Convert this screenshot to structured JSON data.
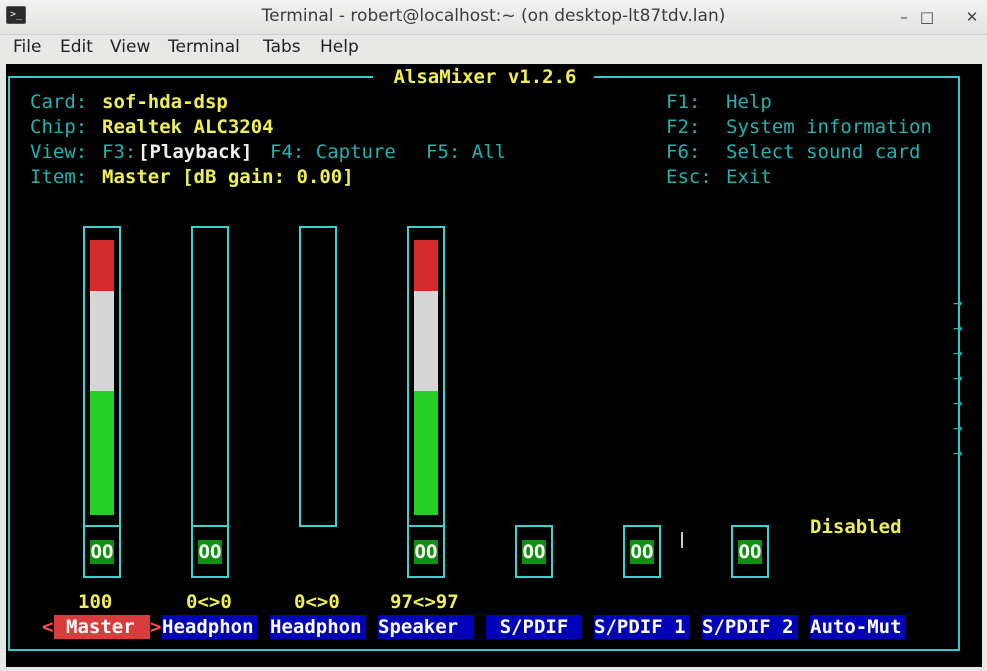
{
  "window": {
    "title": "Terminal - robert@localhost:~ (on desktop-lt87tdv.lan)",
    "icon": "terminal-icon",
    "controls": [
      "–",
      "□",
      "✕"
    ]
  },
  "menu": [
    "File",
    "Edit",
    "View",
    "Terminal",
    "Tabs",
    "Help"
  ],
  "alsamixer": {
    "title": " AlsaMixer v1.2.6 ",
    "card_label": "Card:",
    "card_value": "sof-hda-dsp",
    "chip_label": "Chip:",
    "chip_value": "Realtek ALC3204",
    "view_label": "View:",
    "view_f3": "F3:",
    "view_playback": "[Playback]",
    "view_f4": "F4: Capture",
    "view_f5": "F5: All",
    "item_label": "Item:",
    "item_value": "Master [dB gain: 0.00]",
    "help": [
      {
        "key": "F1:",
        "text": "Help"
      },
      {
        "key": "F2:",
        "text": "System information"
      },
      {
        "key": "F6:",
        "text": "Select sound card"
      },
      {
        "key": "Esc:",
        "text": "Exit"
      }
    ],
    "disabled_text": "Disabled",
    "scroll_arrow": "→",
    "channels": [
      {
        "name": "Master",
        "left_marker": "<",
        "right_marker": ">",
        "value": "100",
        "level": 1.0,
        "switch": "OO"
      },
      {
        "name": "Headphon",
        "value": "0<>0",
        "level": 0,
        "switch": "OO"
      },
      {
        "name": "Headphon",
        "value": "0<>0",
        "level": 0,
        "switch": ""
      },
      {
        "name": "Speaker",
        "value": "97<>97",
        "level": 0.97,
        "switch": "OO"
      },
      {
        "name": "S/PDIF",
        "value": "",
        "switch": "OO"
      },
      {
        "name": "S/PDIF 1",
        "value": "",
        "switch": "OO"
      },
      {
        "name": "S/PDIF 2",
        "value": "",
        "switch": "OO"
      },
      {
        "name": "Auto-Mut",
        "value": "",
        "switch": ""
      }
    ]
  }
}
